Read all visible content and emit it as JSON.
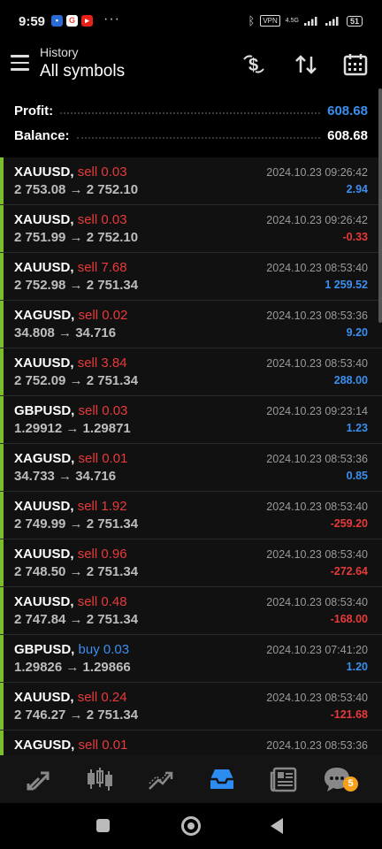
{
  "status": {
    "time": "9:59",
    "dots": "···",
    "vpn": "VPN",
    "net": "4.5G",
    "battery": "51"
  },
  "header": {
    "subtitle": "History",
    "title": "All symbols"
  },
  "summary": {
    "profit_label": "Profit:",
    "profit_value": "608.68",
    "balance_label": "Balance:",
    "balance_value": "608.68"
  },
  "colors": {
    "sell": "#e83a3a",
    "buy": "#3b8ff0",
    "positive": "#3b8ff0",
    "negative": "#e83a3a",
    "accent_bar": "#7bbd2b"
  },
  "trades": [
    {
      "symbol": "XAUUSD,",
      "side": "sell 0.03",
      "type": "sell",
      "prices": "2 753.08 → 2 752.10",
      "time": "2024.10.23 09:26:42",
      "profit": "2.94",
      "sign": "positive"
    },
    {
      "symbol": "XAUUSD,",
      "side": "sell 0.03",
      "type": "sell",
      "prices": "2 751.99 → 2 752.10",
      "time": "2024.10.23 09:26:42",
      "profit": "-0.33",
      "sign": "negative"
    },
    {
      "symbol": "XAUUSD,",
      "side": "sell 7.68",
      "type": "sell",
      "prices": "2 752.98 → 2 751.34",
      "time": "2024.10.23 08:53:40",
      "profit": "1 259.52",
      "sign": "positive"
    },
    {
      "symbol": "XAGUSD,",
      "side": "sell 0.02",
      "type": "sell",
      "prices": "34.808 → 34.716",
      "time": "2024.10.23 08:53:36",
      "profit": "9.20",
      "sign": "positive"
    },
    {
      "symbol": "XAUUSD,",
      "side": "sell 3.84",
      "type": "sell",
      "prices": "2 752.09 → 2 751.34",
      "time": "2024.10.23 08:53:40",
      "profit": "288.00",
      "sign": "positive"
    },
    {
      "symbol": "GBPUSD,",
      "side": "sell 0.03",
      "type": "sell",
      "prices": "1.29912 → 1.29871",
      "time": "2024.10.23 09:23:14",
      "profit": "1.23",
      "sign": "positive"
    },
    {
      "symbol": "XAGUSD,",
      "side": "sell 0.01",
      "type": "sell",
      "prices": "34.733 → 34.716",
      "time": "2024.10.23 08:53:36",
      "profit": "0.85",
      "sign": "positive"
    },
    {
      "symbol": "XAUUSD,",
      "side": "sell 1.92",
      "type": "sell",
      "prices": "2 749.99 → 2 751.34",
      "time": "2024.10.23 08:53:40",
      "profit": "-259.20",
      "sign": "negative"
    },
    {
      "symbol": "XAUUSD,",
      "side": "sell 0.96",
      "type": "sell",
      "prices": "2 748.50 → 2 751.34",
      "time": "2024.10.23 08:53:40",
      "profit": "-272.64",
      "sign": "negative"
    },
    {
      "symbol": "XAUUSD,",
      "side": "sell 0.48",
      "type": "sell",
      "prices": "2 747.84 → 2 751.34",
      "time": "2024.10.23 08:53:40",
      "profit": "-168.00",
      "sign": "negative"
    },
    {
      "symbol": "GBPUSD,",
      "side": "buy 0.03",
      "type": "buy",
      "prices": "1.29826 → 1.29866",
      "time": "2024.10.23 07:41:20",
      "profit": "1.20",
      "sign": "positive"
    },
    {
      "symbol": "XAUUSD,",
      "side": "sell 0.24",
      "type": "sell",
      "prices": "2 746.27 → 2 751.34",
      "time": "2024.10.23 08:53:40",
      "profit": "-121.68",
      "sign": "negative"
    },
    {
      "symbol": "XAGUSD,",
      "side": "sell 0.01",
      "type": "sell",
      "prices": "",
      "time": "2024.10.23 08:53:36",
      "profit": "",
      "sign": "positive"
    }
  ],
  "bottom_nav": {
    "items": [
      "quotes-icon",
      "chart-icon",
      "trade-icon",
      "history-icon",
      "news-icon",
      "chat-icon"
    ],
    "active": "history-icon",
    "chat_badge": "5"
  }
}
